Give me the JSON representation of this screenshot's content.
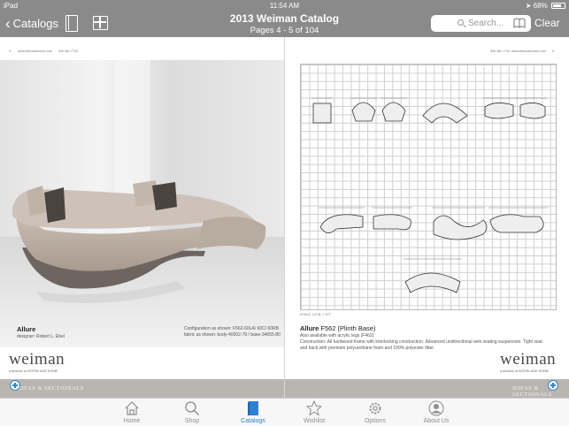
{
  "status_bar": {
    "carrier": "iPad",
    "time": "11:54 AM",
    "battery": "68%"
  },
  "nav": {
    "back_label": "Catalogs",
    "title": "2013 Weiman Catalog",
    "subtitle": "Pages 4 - 5 of 104",
    "search_placeholder": "Search...",
    "clear_label": "Clear"
  },
  "left_page": {
    "page_number": "4",
    "header_url": "www.interludehome.com",
    "header_phone": "540.381.7740",
    "product_name": "Allure",
    "designer": "designer: Robert L. Ebel",
    "config_line1": "Configuration as shown: F562-60LA/ 60C/ 60RB",
    "config_line2": "fabric as shown: body-40002-79 / base-34655-80",
    "logo": "weiman",
    "logo_tag": "a division of INTERLUDE HOME",
    "footer_label": "SOFAS & SECTIONALS"
  },
  "right_page": {
    "page_number": "5",
    "header_phone": "540.381.7740",
    "header_url": "www.interludehome.com",
    "scale_label": "SCALE: 1/4 IN. = 1FT",
    "product_name": "Allure",
    "product_code": "F562 (Plinth Base)",
    "line1": "Also available with acrylic legs (F462).",
    "line2": "Construction: All hardwood frame with interlocking construction. Advanced unidirectional web seating suspension. Tight seat",
    "line3": "and back with premium polyurethane foam and 100% polyester fiber.",
    "logo": "weiman",
    "logo_tag": "a division of INTERLUDE HOME",
    "footer_label": "SOFAS & SECTIONALS"
  },
  "tabs": [
    {
      "label": "Home",
      "icon": "home-icon"
    },
    {
      "label": "Shop",
      "icon": "search-icon"
    },
    {
      "label": "Catalogs",
      "icon": "catalog-book-icon"
    },
    {
      "label": "Wishlist",
      "icon": "star-icon"
    },
    {
      "label": "Options",
      "icon": "gear-icon"
    },
    {
      "label": "About Us",
      "icon": "person-icon"
    }
  ],
  "colors": {
    "nav_bg": "#8a8a8a",
    "accent": "#2d82d6",
    "footer_band": "#b9b6b1"
  }
}
